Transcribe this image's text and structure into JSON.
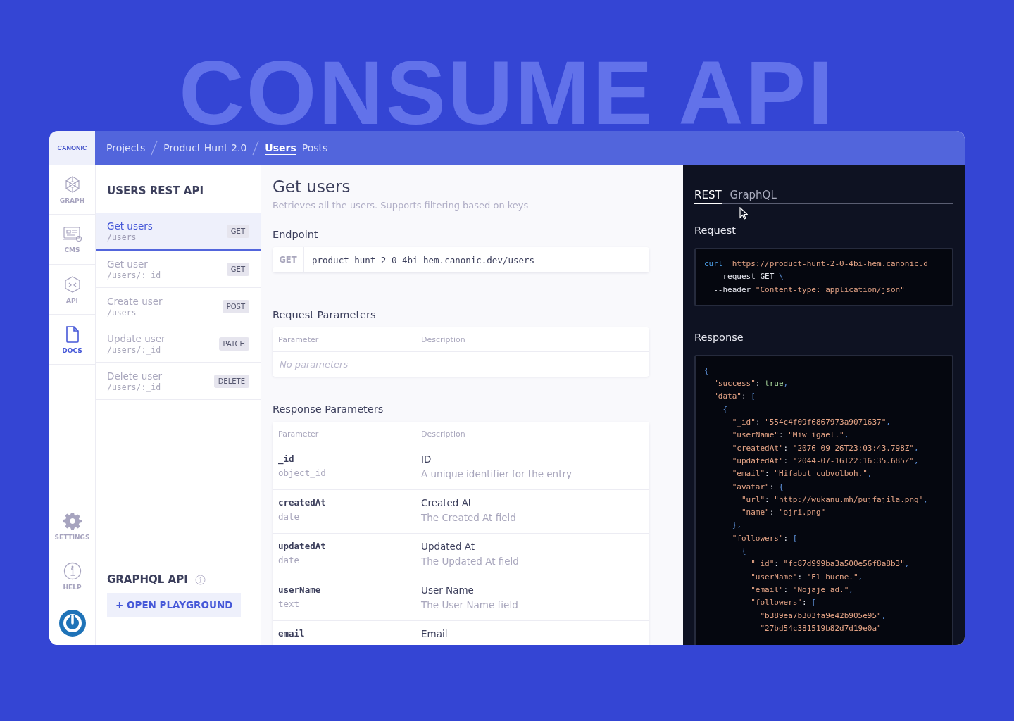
{
  "hero": {
    "title": "CONSUME API"
  },
  "brand": {
    "name": "CANONIC"
  },
  "breadcrumbs": [
    "Projects",
    "Product Hunt 2.0"
  ],
  "tabs": [
    {
      "label": "Users",
      "selected": true
    },
    {
      "label": "Posts",
      "selected": false
    }
  ],
  "rail": [
    {
      "label": "GRAPH",
      "selected": false
    },
    {
      "label": "CMS",
      "selected": false
    },
    {
      "label": "API",
      "selected": false
    },
    {
      "label": "DOCS",
      "selected": true
    }
  ],
  "rail_bottom": [
    {
      "label": "SETTINGS"
    },
    {
      "label": "HELP"
    }
  ],
  "sidebar": {
    "title": "USERS REST API",
    "endpoints": [
      {
        "name": "Get users",
        "path": "/users",
        "method": "GET",
        "selected": true
      },
      {
        "name": "Get user",
        "path": "/users/:_id",
        "method": "GET",
        "selected": false
      },
      {
        "name": "Create user",
        "path": "/users",
        "method": "POST",
        "selected": false
      },
      {
        "name": "Update user",
        "path": "/users/:_id",
        "method": "PATCH",
        "selected": false
      },
      {
        "name": "Delete user",
        "path": "/users/:_id",
        "method": "DELETE",
        "selected": false
      }
    ],
    "graphql_title": "GRAPHQL API",
    "playground_button": "+ OPEN PLAYGROUND"
  },
  "main": {
    "title": "Get users",
    "subtitle": "Retrieves all the users. Supports filtering based on keys",
    "endpoint_heading": "Endpoint",
    "endpoint": {
      "method": "GET",
      "url": "product-hunt-2-0-4bi-hem.canonic.dev/users"
    },
    "request_heading": "Request Parameters",
    "request_columns": [
      "Parameter",
      "Description"
    ],
    "request_empty": "No parameters",
    "response_heading": "Response Parameters",
    "response_columns": [
      "Parameter",
      "Description"
    ],
    "response_rows": [
      {
        "name": "_id",
        "type": "object_id",
        "label": "ID",
        "description": "A unique identifier for the entry"
      },
      {
        "name": "createdAt",
        "type": "date",
        "label": "Created At",
        "description": "The Created At field"
      },
      {
        "name": "updatedAt",
        "type": "date",
        "label": "Updated At",
        "description": "The Updated At field"
      },
      {
        "name": "userName",
        "type": "text",
        "label": "User Name",
        "description": "The User Name field"
      },
      {
        "name": "email",
        "label": "Email"
      }
    ]
  },
  "panel": {
    "tabs": [
      {
        "label": "REST",
        "selected": true
      },
      {
        "label": "GraphQL",
        "selected": false
      }
    ],
    "request_heading": "Request",
    "request_code": [
      "curl 'https://product-hunt-2-0-4bi-hem.canonic.d",
      "  --request GET \\",
      "  --header \"Content-type: application/json\""
    ],
    "response_heading": "Response",
    "response_code": [
      "{",
      "  \"success\": true,",
      "  \"data\": [",
      "    {",
      "      \"_id\": \"554c4f09f6867973a9071637\",",
      "      \"userName\": \"Miw igael.\",",
      "      \"createdAt\": \"2076-09-26T23:03:43.798Z\",",
      "      \"updatedAt\": \"2044-07-16T22:16:35.685Z\",",
      "      \"email\": \"Hifabut cubvolboh.\",",
      "      \"avatar\": {",
      "        \"url\": \"http://wukanu.mh/pujfajila.png\",",
      "        \"name\": \"ojri.png\"",
      "      },",
      "      \"followers\": [",
      "        {",
      "          \"_id\": \"fc87d999ba3a500e56f8a8b3\",",
      "          \"userName\": \"El bucne.\",",
      "          \"email\": \"Nojaje ad.\",",
      "          \"followers\": [",
      "            \"b389ea7b303fa9e42b905e95\",",
      "            \"27bd54c381519b82d7d19e0a\""
    ]
  }
}
